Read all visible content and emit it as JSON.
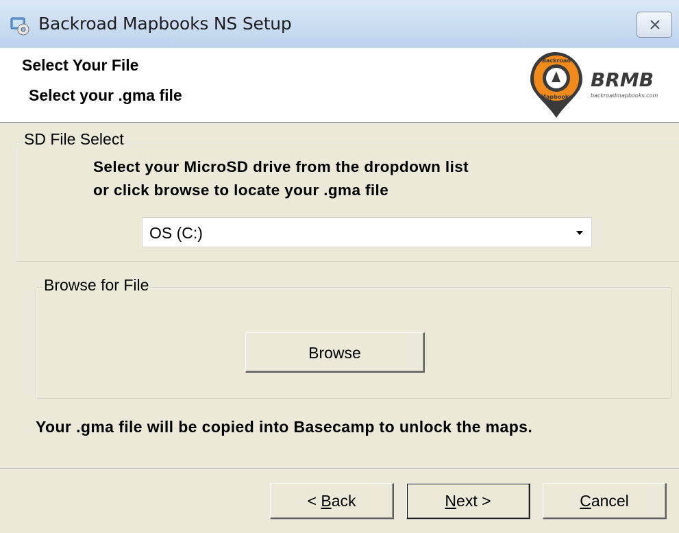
{
  "window": {
    "title": "Backroad Mapbooks NS Setup",
    "icon": "setup-app-icon",
    "close_icon": "close-icon"
  },
  "header": {
    "title": "Select Your File",
    "subtitle": "Select your .gma file",
    "logo": {
      "circle_text_top": "Backroad",
      "circle_text_bottom": "Mapbooks",
      "brand": "BRMB",
      "url": "backroadmapbooks.com",
      "accent": "#f08a1c"
    }
  },
  "sd_group": {
    "legend": "SD File Select",
    "instruction_line1": "Select your MicroSD drive from the dropdown list",
    "instruction_line2": "or click browse to locate your .gma file",
    "dropdown": {
      "selected": "OS (C:)"
    }
  },
  "browse_group": {
    "legend": "Browse for File",
    "browse_label": "Browse"
  },
  "note": "Your .gma file will be copied into Basecamp to unlock the maps.",
  "footer": {
    "back": {
      "prefix": "< ",
      "mnemonic": "B",
      "rest": "ack"
    },
    "next": {
      "mnemonic": "N",
      "rest": "ext >"
    },
    "cancel": {
      "mnemonic": "C",
      "rest": "ancel"
    }
  },
  "colors": {
    "dialog_bg": "#ece9d8",
    "titlebar": "#c9dcf0",
    "logo_orange": "#f08a1c",
    "logo_dark": "#3a3a3a"
  }
}
